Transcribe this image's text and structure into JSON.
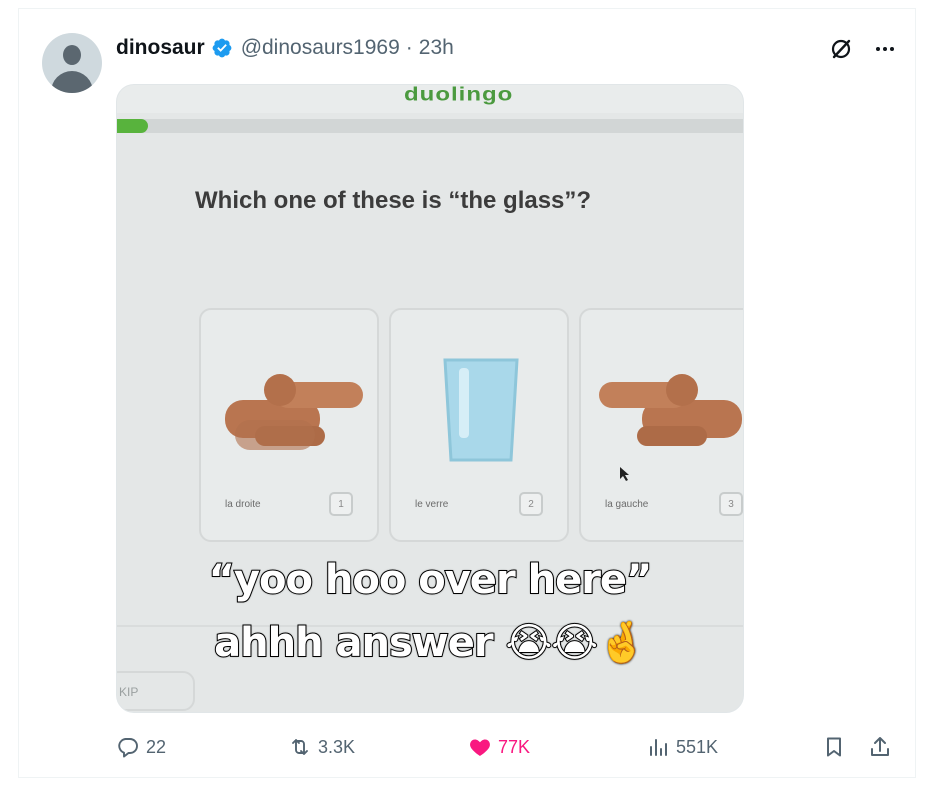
{
  "post": {
    "author_name": "dinosaur",
    "handle": "@dinosaurs1969",
    "separator": "·",
    "time": "23h"
  },
  "media": {
    "brand": "duolingo",
    "progress": 0.05,
    "question": "Which one of these is “the glass”?",
    "cards": [
      {
        "word": "la droite",
        "num": "1"
      },
      {
        "word": "le verre",
        "num": "2"
      },
      {
        "word": "la gauche",
        "num": "3"
      }
    ],
    "skip": "KIP",
    "caption_line1": "“yoo hoo over here”",
    "caption_line2": "ahhh answer 😭😭🤞"
  },
  "actions": {
    "replies": "22",
    "reposts": "3.3K",
    "likes": "77K",
    "views": "551K"
  },
  "colors": {
    "like": "#f91880",
    "verified": "#1d9bf0",
    "muted": "#536471",
    "duolingo_green": "#58b33d"
  },
  "icons": [
    "verified-badge-icon",
    "grok-icon",
    "more-icon",
    "reply-icon",
    "repost-icon",
    "like-icon",
    "views-icon",
    "bookmark-icon",
    "share-icon"
  ]
}
